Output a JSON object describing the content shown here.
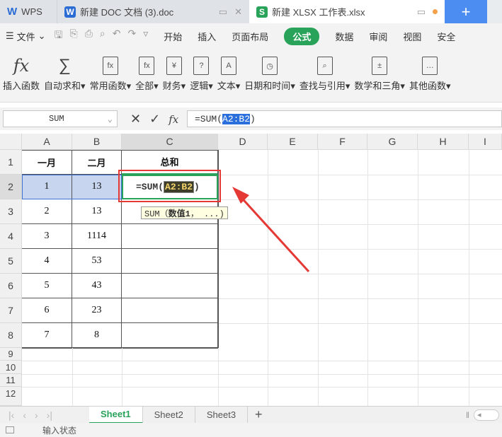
{
  "tabs": {
    "wps_label": "WPS",
    "doc_label": "新建 DOC 文档 (3).doc",
    "xls_label": "新建 XLSX 工作表.xlsx",
    "add_label": "+"
  },
  "menu": {
    "file_label": "文件",
    "items": [
      "开始",
      "插入",
      "页面布局",
      "公式",
      "数据",
      "审阅",
      "视图",
      "安全"
    ],
    "active": "公式"
  },
  "ribbon": {
    "buttons": [
      {
        "label": "插入函数",
        "icon": "fx-icon"
      },
      {
        "label": "自动求和",
        "icon": "sigma-icon"
      },
      {
        "label": "常用函数",
        "icon": "star-fx-icon"
      },
      {
        "label": "全部",
        "icon": "fx-book-icon"
      },
      {
        "label": "财务",
        "icon": "yen-book-icon"
      },
      {
        "label": "逻辑",
        "icon": "question-book-icon"
      },
      {
        "label": "文本",
        "icon": "a-book-icon"
      },
      {
        "label": "日期和时间",
        "icon": "clock-book-icon"
      },
      {
        "label": "查找与引用",
        "icon": "search-book-icon"
      },
      {
        "label": "数学和三角",
        "icon": "math-book-icon"
      },
      {
        "label": "其他函数",
        "icon": "dots-book-icon"
      }
    ]
  },
  "formula_bar": {
    "name_box": "SUM",
    "formula_prefix": "=SUM(",
    "formula_ref": "A2:B2",
    "formula_suffix": ")"
  },
  "columns": [
    "A",
    "B",
    "C",
    "D",
    "E",
    "F",
    "G",
    "H",
    "I"
  ],
  "rows": [
    "1",
    "2",
    "3",
    "4",
    "5",
    "6",
    "7",
    "8",
    "9",
    "10",
    "11",
    "12"
  ],
  "table": {
    "headers": [
      "一月",
      "二月",
      "总和"
    ],
    "data": [
      [
        "1",
        "13"
      ],
      [
        "2",
        "13"
      ],
      [
        "3",
        "1114"
      ],
      [
        "4",
        "53"
      ],
      [
        "5",
        "43"
      ],
      [
        "6",
        "23"
      ],
      [
        "7",
        "8"
      ]
    ]
  },
  "editing_cell": {
    "prefix": "=SUM(",
    "ref": "A2:B2",
    "suffix": ")"
  },
  "tooltip": {
    "prefix": "SUM（",
    "arg": "数值1",
    "suffix": "， ...)"
  },
  "sheets": [
    "Sheet1",
    "Sheet2",
    "Sheet3"
  ],
  "active_sheet": "Sheet1",
  "status": "输入状态",
  "colors": {
    "accent_green": "#2aa35a",
    "annotation_red": "#e53935",
    "selection_blue": "#c7d6ee"
  }
}
